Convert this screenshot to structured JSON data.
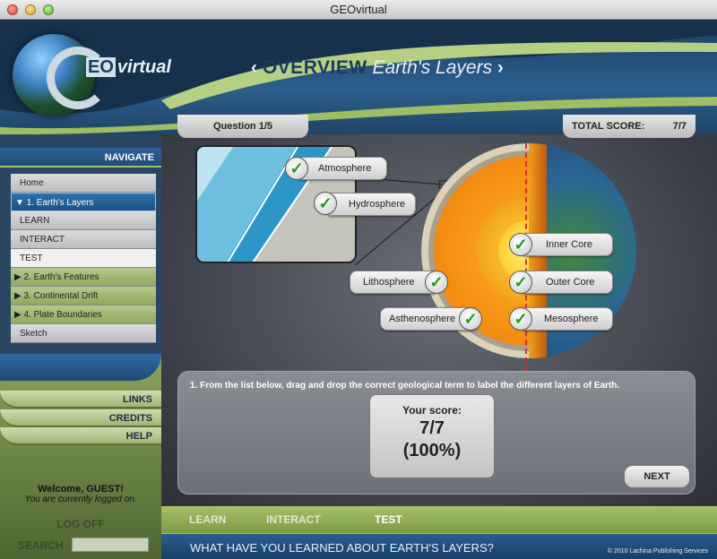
{
  "window": {
    "title": "GEOvirtual"
  },
  "logo": {
    "g": "G",
    "eo": "EO",
    "rest": "virtual"
  },
  "header": {
    "left_arrow": "‹",
    "section": "OVERVIEW",
    "topic": "Earth's Layers",
    "right_arrow": "›"
  },
  "sidebar": {
    "navigate": "NAVIGATE",
    "menu": [
      {
        "label": "Home"
      },
      {
        "label": "1. Earth's Layers"
      },
      {
        "label": "LEARN"
      },
      {
        "label": "INTERACT"
      },
      {
        "label": "TEST"
      },
      {
        "label": "2. Earth's Features"
      },
      {
        "label": "3. Continental Drift"
      },
      {
        "label": "4. Plate Boundaries"
      },
      {
        "label": "Sketch"
      }
    ],
    "links": "LINKS",
    "credits": "CREDITS",
    "help": "HELP",
    "welcome": "Welcome, GUEST!",
    "logged": "You are currently logged on.",
    "logoff": "LOG OFF",
    "search_label": "SEARCH",
    "search_value": ""
  },
  "quiz": {
    "question_label": "Question 1/5",
    "total_score_label": "TOTAL SCORE:",
    "total_score_value": "7/7",
    "labels": {
      "atmosphere": "Atmosphere",
      "hydrosphere": "Hydrosphere",
      "inner_core": "Inner Core",
      "lithosphere": "Lithosphere",
      "outer_core": "Outer Core",
      "asthenosphere": "Asthenosphere",
      "mesosphere": "Mesosphere"
    },
    "instruction": "1. From the list below, drag and drop the correct geological term to label the different layers of Earth.",
    "your_score_label": "Your score:",
    "score_fraction": "7/7",
    "score_percent": "(100%)",
    "next": "NEXT"
  },
  "tabs": {
    "learn": "LEARN",
    "interact": "INTERACT",
    "test": "TEST"
  },
  "footer": {
    "text": "WHAT HAVE YOU LEARNED ABOUT EARTH'S LAYERS?",
    "copyright": "© 2010 Lachina Publishing Services"
  },
  "colors": {
    "check": "#1c9a1c",
    "cut_line": "#d03030"
  }
}
